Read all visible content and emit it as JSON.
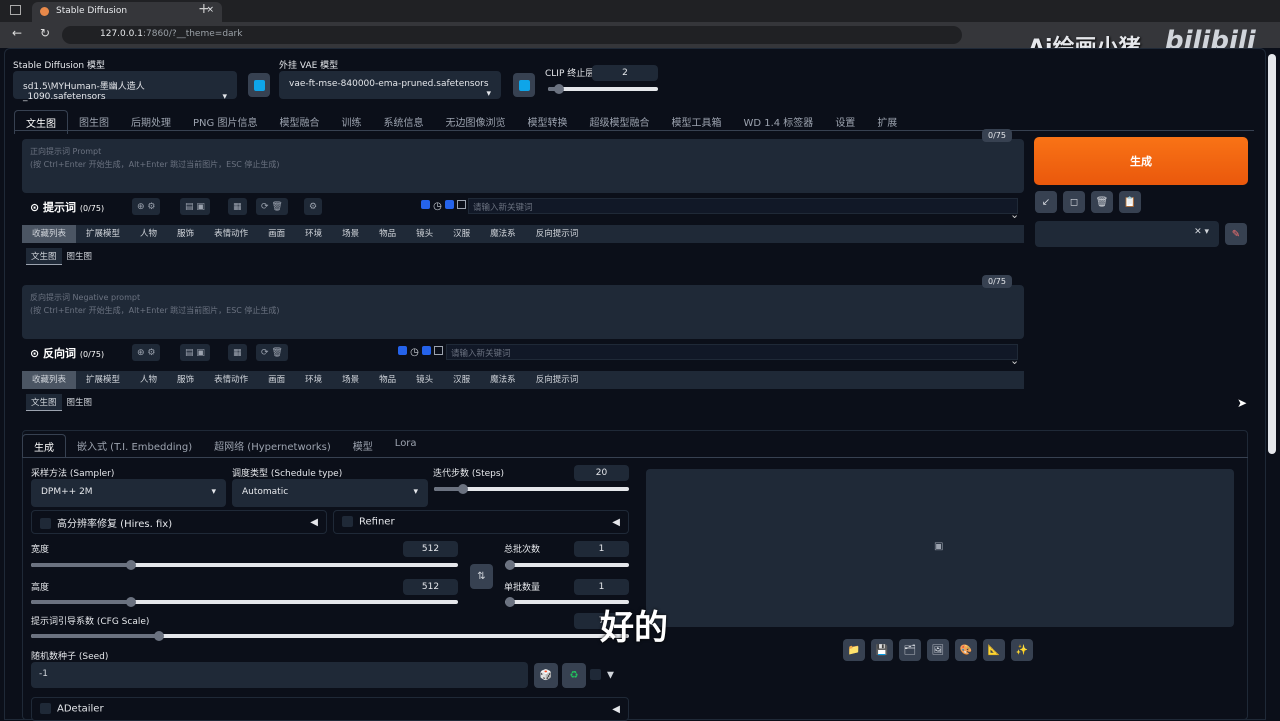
{
  "browser": {
    "tab_title": "Stable Diffusion",
    "url_host": "127.0.0.1",
    "url_rest": ":7860/?__theme=dark",
    "new_tab": "+",
    "close_tab": "×"
  },
  "watermark": {
    "channel": "Ai绘画小猪",
    "brand": "bilibili",
    "subtitle": "好的"
  },
  "top": {
    "sd_label": "Stable Diffusion 模型",
    "sd_value": "sd1.5\\MYHuman-墨幽人造人_1090.safetensors",
    "vae_label": "外挂 VAE 模型",
    "vae_value": "vae-ft-mse-840000-ema-pruned.safetensors",
    "clip_label": "CLIP 终止层数",
    "clip_value": "2",
    "clip_fraction": 0.08
  },
  "tabs": [
    "文生图",
    "图生图",
    "后期处理",
    "PNG 图片信息",
    "模型融合",
    "训练",
    "系统信息",
    "无边图像浏览",
    "模型转换",
    "超级模型融合",
    "模型工具箱",
    "WD 1.4 标签器",
    "设置",
    "扩展"
  ],
  "prompt": {
    "placeholder1": "正向提示词 Prompt",
    "placeholder2": "(按 Ctrl+Enter 开始生成，Alt+Enter 跳过当前图片，ESC 停止生成)",
    "count": "0/75",
    "title": "提示词",
    "title_count": "(0/75)",
    "kw_placeholder": "请输入新关键词"
  },
  "neg": {
    "placeholder1": "反向提示词 Negative prompt",
    "placeholder2": "(按 Ctrl+Enter 开始生成，Alt+Enter 跳过当前图片，ESC 停止生成)",
    "count": "0/75",
    "title": "反向词",
    "title_count": "(0/75)",
    "kw_placeholder": "请输入新关键词"
  },
  "categories": [
    "收藏列表",
    "扩展模型",
    "人物",
    "服饰",
    "表情动作",
    "画面",
    "环境",
    "场景",
    "物品",
    "镜头",
    "汉服",
    "魔法系",
    "反向提示词"
  ],
  "subtabs": [
    "文生图",
    "图生图"
  ],
  "generate": {
    "label": "生成",
    "color": "#ea580c"
  },
  "gen_tabs": [
    "生成",
    "嵌入式 (T.I. Embedding)",
    "超网络 (Hypernetworks)",
    "模型",
    "Lora"
  ],
  "params": {
    "sampler_label": "采样方法 (Sampler)",
    "sampler": "DPM++ 2M",
    "schedule_label": "调度类型 (Schedule type)",
    "schedule": "Automatic",
    "steps_label": "迭代步数 (Steps)",
    "steps": "20",
    "hires": "高分辨率修复 (Hires. fix)",
    "refiner": "Refiner",
    "width_label": "宽度",
    "width": "512",
    "height_label": "高度",
    "height": "512",
    "batch_count_label": "总批次数",
    "batch_count": "1",
    "batch_size_label": "单批数量",
    "batch_size": "1",
    "cfg_label": "提示词引导系数 (CFG Scale)",
    "cfg": "7",
    "seed_label": "随机数种子 (Seed)",
    "seed": "-1",
    "adetailer": "ADetailer"
  }
}
